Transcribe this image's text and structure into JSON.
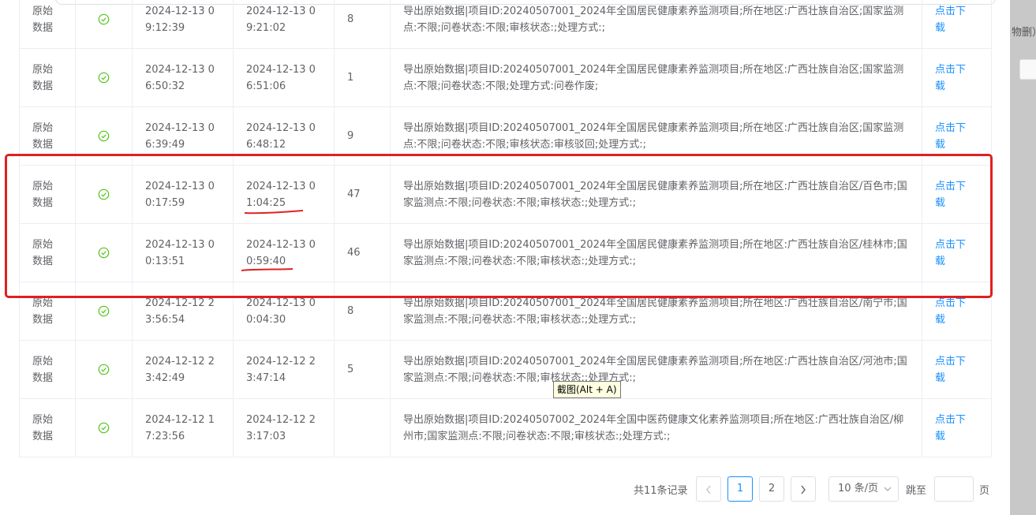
{
  "background_window": {
    "partial_text": "物删）"
  },
  "table": {
    "rows": [
      {
        "type": "原始数据",
        "status": "success",
        "start": "2024-12-13 09:12:39",
        "end": "2024-12-13 09:21:02",
        "count": "8",
        "description": "导出原始数据|项目ID:20240507001_2024年全国居民健康素养监测项目;所在地区:广西壮族自治区;国家监测点:不限;问卷状态:不限;审核状态:;处理方式:;",
        "action": "点击下载"
      },
      {
        "type": "原始数据",
        "status": "success",
        "start": "2024-12-13 06:50:32",
        "end": "2024-12-13 06:51:06",
        "count": "1",
        "description": "导出原始数据|项目ID:20240507001_2024年全国居民健康素养监测项目;所在地区:广西壮族自治区;国家监测点:不限;问卷状态:不限;处理方式:问卷作废;",
        "action": "点击下载"
      },
      {
        "type": "原始数据",
        "status": "success",
        "start": "2024-12-13 06:39:49",
        "end": "2024-12-13 06:48:12",
        "count": "9",
        "description": "导出原始数据|项目ID:20240507001_2024年全国居民健康素养监测项目;所在地区:广西壮族自治区;国家监测点:不限;问卷状态:不限;审核状态:审核驳回;处理方式:;",
        "action": "点击下载"
      },
      {
        "type": "原始数据",
        "status": "success",
        "start": "2024-12-13 00:17:59",
        "end": "2024-12-13 01:04:25",
        "count": "47",
        "description": "导出原始数据|项目ID:20240507001_2024年全国居民健康素养监测项目;所在地区:广西壮族自治区/百色市;国家监测点:不限;问卷状态:不限;审核状态:;处理方式:;",
        "action": "点击下载"
      },
      {
        "type": "原始数据",
        "status": "success",
        "start": "2024-12-13 00:13:51",
        "end": "2024-12-13 00:59:40",
        "count": "46",
        "description": "导出原始数据|项目ID:20240507001_2024年全国居民健康素养监测项目;所在地区:广西壮族自治区/桂林市;国家监测点:不限;问卷状态:不限;审核状态:;处理方式:;",
        "action": "点击下载"
      },
      {
        "type": "原始数据",
        "status": "success",
        "start": "2024-12-12 23:56:54",
        "end": "2024-12-13 00:04:30",
        "count": "8",
        "description": "导出原始数据|项目ID:20240507001_2024年全国居民健康素养监测项目;所在地区:广西壮族自治区/南宁市;国家监测点:不限;问卷状态:不限;审核状态:;处理方式:;",
        "action": "点击下载"
      },
      {
        "type": "原始数据",
        "status": "success",
        "start": "2024-12-12 23:42:49",
        "end": "2024-12-12 23:47:14",
        "count": "5",
        "description": "导出原始数据|项目ID:20240507001_2024年全国居民健康素养监测项目;所在地区:广西壮族自治区/河池市;国家监测点:不限;问卷状态:不限;审核状态:;处理方式:;",
        "action": "点击下载"
      },
      {
        "type": "原始数据",
        "status": "success",
        "start": "2024-12-12 17:23:56",
        "end": "2024-12-12 23:17:03",
        "count": "",
        "description": "导出原始数据|项目ID:20240507002_2024年全国中医药健康文化素养监测项目;所在地区:广西壮族自治区/柳州市;国家监测点:不限;问卷状态:不限;审核状态:;处理方式:;",
        "action": "点击下载"
      }
    ]
  },
  "tooltip": {
    "text": "截图(Alt + A)"
  },
  "pagination": {
    "total_text": "共11条记录",
    "prev_icon": "chevron-left-icon",
    "next_icon": "chevron-right-icon",
    "pages": [
      "1",
      "2"
    ],
    "current_page": "1",
    "page_size_label": "10 条/页",
    "jump_label": "跳至",
    "jump_value": "",
    "page_unit": "页"
  },
  "colors": {
    "link": "#1890ff",
    "success": "#52c41a",
    "highlight": "#e02020",
    "border": "#ebeef5",
    "text": "#606266"
  }
}
